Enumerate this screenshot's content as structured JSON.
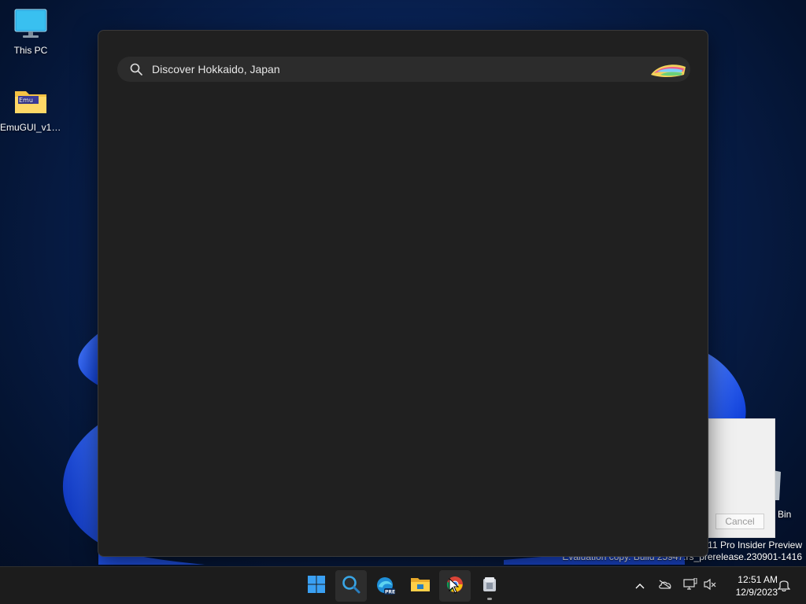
{
  "desktop": {
    "icons": [
      {
        "label": "This PC",
        "icon": "monitor-icon"
      },
      {
        "label": "EmuGUI_v1....",
        "icon": "folder-icon"
      }
    ],
    "recycle_bin_label": "Bin"
  },
  "search": {
    "value": "Discover Hokkaido, Japan",
    "search_icon": "search-icon",
    "highlight_icon": "search-highlight-icon"
  },
  "dialog": {
    "cancel_label": "Cancel"
  },
  "watermark": {
    "line1": "s 11 Pro Insider Preview",
    "line2": "Evaluation copy. Build 25947.rs_prerelease.230901-1416"
  },
  "taskbar": {
    "buttons": [
      {
        "name": "start",
        "icon": "windows-logo-icon"
      },
      {
        "name": "search",
        "icon": "search-icon"
      },
      {
        "name": "edge",
        "icon": "edge-beta-icon",
        "badge": "PRE"
      },
      {
        "name": "file-explorer",
        "icon": "folder-icon"
      },
      {
        "name": "chrome",
        "icon": "chrome-icon"
      },
      {
        "name": "app",
        "icon": "installer-icon"
      }
    ],
    "tray": [
      "chevron-up-icon",
      "onedrive-icon",
      "network-icon",
      "volume-muted-icon"
    ],
    "time": "12:51 AM",
    "date": "12/9/2023",
    "notification_icon": "bell-icon"
  },
  "colors": {
    "flyout_bg": "#202020",
    "search_bg": "#2c2c2c",
    "taskbar_bg": "#1c1c1c",
    "accent": "#0078d4"
  }
}
